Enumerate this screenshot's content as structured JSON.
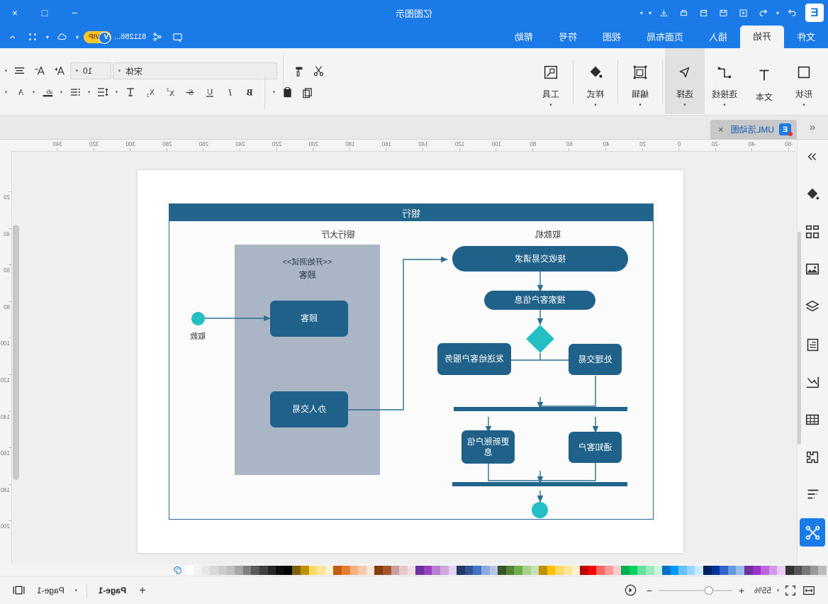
{
  "window": {
    "title": "亿图图示",
    "logo_text": "E",
    "minimize": "−",
    "maximize": "□",
    "close": "×",
    "quick_access": [
      "undo-icon",
      "redo-icon",
      "new-icon",
      "open-icon",
      "save-icon",
      "print-icon",
      "export-icon",
      "more-caret"
    ]
  },
  "ribbon": {
    "tabs": [
      {
        "label": "文件",
        "active": false
      },
      {
        "label": "开始",
        "active": true
      },
      {
        "label": "插入",
        "active": false
      },
      {
        "label": "页面布局",
        "active": false
      },
      {
        "label": "视图",
        "active": false
      },
      {
        "label": "符号",
        "active": false
      },
      {
        "label": "帮助",
        "active": false
      }
    ],
    "account": {
      "vip_label": "VIP",
      "vip_v": "V",
      "user_id": "811286...",
      "icons": [
        "comment-icon",
        "share-icon",
        "cloud-icon",
        "grid-icon",
        "chevron-up-icon"
      ]
    },
    "groups": [
      {
        "label": "形状",
        "icon": "square-icon",
        "caret": "▾",
        "selected": false
      },
      {
        "label": "文本",
        "icon": "text-T-icon",
        "caret": "",
        "selected": false
      },
      {
        "label": "连接线",
        "icon": "connector-icon",
        "caret": "▾",
        "selected": false
      },
      {
        "label": "选择",
        "icon": "cursor-arrow-icon",
        "caret": "▾",
        "selected": true
      },
      {
        "label": "编辑",
        "icon": "edit-frame-icon",
        "caret": "▾",
        "selected": false
      },
      {
        "label": "样式",
        "icon": "paint-bucket-icon",
        "caret": "▾",
        "selected": false
      },
      {
        "label": "工具",
        "icon": "toolbox-icon",
        "caret": "▾",
        "selected": false
      }
    ],
    "font": {
      "family_value": "宋体",
      "size_value": "10",
      "caret": "▾"
    },
    "format_row1": [
      "align-icon",
      "decrease-font-icon",
      "increase-font-icon"
    ],
    "format_row2": [
      "font-color-A-icon",
      "highlight-ab-icon",
      "list-icon",
      "line-spacing-icon",
      "text-direction-icon",
      "subscript-icon",
      "superscript-icon",
      "strikethrough-icon",
      "underline-icon",
      "italic-icon",
      "bold-icon"
    ],
    "clipboard": [
      "cut-scissors-icon",
      "format-painter-icon",
      "copy-icon",
      "paste-icon"
    ]
  },
  "doc_tab": {
    "collapse_icon": "«",
    "tab_icon_letter": "E",
    "name": "UML活动图",
    "close": "×"
  },
  "left_sidebar": {
    "items": [
      {
        "name": "expand-panel-icon",
        "active": false
      },
      {
        "name": "fill-bucket-icon",
        "active": false
      },
      {
        "name": "shapes-grid-icon",
        "active": false
      },
      {
        "name": "image-icon",
        "active": false
      },
      {
        "name": "layers-icon",
        "active": false
      },
      {
        "name": "notes-icon",
        "active": false
      },
      {
        "name": "chart-icon",
        "active": false
      },
      {
        "name": "table-icon",
        "active": false
      },
      {
        "name": "puzzle-icon",
        "active": false
      },
      {
        "name": "gantt-icon",
        "active": false
      },
      {
        "name": "connector-mode-icon",
        "active": true
      }
    ]
  },
  "rulers": {
    "horizontal": [
      "-60",
      "-40",
      "-20",
      "0",
      "20",
      "40",
      "60",
      "80",
      "100",
      "120",
      "140",
      "160",
      "180",
      "200",
      "220",
      "240",
      "260",
      "280",
      "300",
      "320",
      "340"
    ],
    "vertical": [
      "20",
      "40",
      "60",
      "80",
      "100",
      "120",
      "140",
      "160",
      "180",
      "200"
    ]
  },
  "diagram": {
    "title": "银行",
    "lanes": [
      {
        "label": "银行大厅"
      },
      {
        "label": "取款机"
      }
    ],
    "actor_box": {
      "stereotype": "<<开始测试>>",
      "name": "顾客"
    },
    "nodes": [
      {
        "id": "customer",
        "label": "顾客",
        "shape": "rounded"
      },
      {
        "id": "handle_txn",
        "label": "办人交易",
        "shape": "rounded"
      },
      {
        "id": "receive_req",
        "label": "接收交易请求",
        "shape": "pill"
      },
      {
        "id": "search_info",
        "label": "搜索客户信息",
        "shape": "pill"
      },
      {
        "id": "process_txn",
        "label": "处理交易",
        "shape": "rounded"
      },
      {
        "id": "send_service",
        "label": "发送给客户服务",
        "shape": "rounded"
      },
      {
        "id": "notify_customer",
        "label": "通知客户",
        "shape": "rounded"
      },
      {
        "id": "update_account",
        "label": "更新账户信息",
        "shape": "rounded"
      }
    ],
    "decision": {
      "shape": "diamond"
    },
    "end_node_label": "取款",
    "final_node": {
      "shape": "circle"
    }
  },
  "status_bar": {
    "fit_width_icon": "fit-width-icon",
    "fit_page_icon": "fit-page-icon",
    "zoom_caret": "▾",
    "zoom_value": "55%",
    "zoom_in": "+",
    "zoom_out": "−",
    "prev_page_icon": "prev-page-icon",
    "add_page": "+",
    "active_page": "Page-1",
    "page_caret": "▾",
    "page_label": "Page-1",
    "view_mode_icon": "view-mode-icon"
  },
  "palette": {
    "swatches": [
      "#ffffff",
      "#f2f2f2",
      "#e6e6e6",
      "#d9d9d9",
      "#cccccc",
      "#bfbfbf",
      "#a6a6a6",
      "#808080",
      "#595959",
      "#404040",
      "#262626",
      "#0d0d0d",
      "#000000",
      "#7f6000",
      "#bf9000",
      "#ffd966",
      "#ffe599",
      "#fff2cc",
      "#c55a11",
      "#e87d2b",
      "#f4b183",
      "#f8cbad",
      "#fbe5d6",
      "#833c0c",
      "#a6522c",
      "#c9a0a0",
      "#e8c7c7",
      "#f2dede",
      "#7030a0",
      "#9a3fbf",
      "#b47fd0",
      "#cfa8e0",
      "#e4d0f0",
      "#203864",
      "#2e5496",
      "#4472c4",
      "#8faadc",
      "#b4c7e7",
      "#375623",
      "#548235",
      "#70ad47",
      "#a9d18e",
      "#c5e0b4",
      "#bf8f00",
      "#ffc000",
      "#ffd966",
      "#ffe699",
      "#fff2cc",
      "#c00000",
      "#ff0000",
      "#ff6666",
      "#ff9999",
      "#ffcccc",
      "#00b050",
      "#00d264",
      "#66e09a",
      "#99ebbb",
      "#ccf5dd",
      "#0070c0",
      "#0099ff",
      "#66c2ff",
      "#99d6ff",
      "#cce9ff",
      "#002060",
      "#003399",
      "#3366cc",
      "#6699e0",
      "#99bbf0",
      "#7030a0",
      "#9933cc",
      "#bb66dd",
      "#d199e8",
      "#e8ccf4",
      "#333333",
      "#555555",
      "#777777",
      "#999999",
      "#bbbbbb"
    ],
    "more_icon": "palette-more-icon"
  }
}
